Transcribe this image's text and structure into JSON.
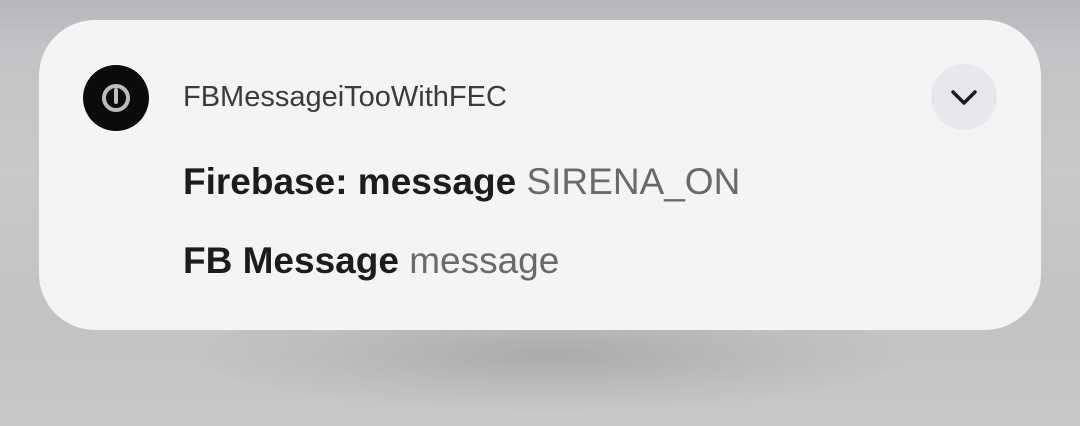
{
  "notification": {
    "app_name": "FBMessageiTooWithFEC",
    "app_icon": "power-icon",
    "expand_icon": "chevron-down-icon",
    "messages": [
      {
        "title": "Firebase: message",
        "body": "SIRENA_ON"
      },
      {
        "title": "FB Message",
        "body": "message"
      }
    ]
  },
  "colors": {
    "card_background": "#f4f4f5",
    "title_text": "#1c1c1e",
    "body_text": "#6a6a6e"
  }
}
